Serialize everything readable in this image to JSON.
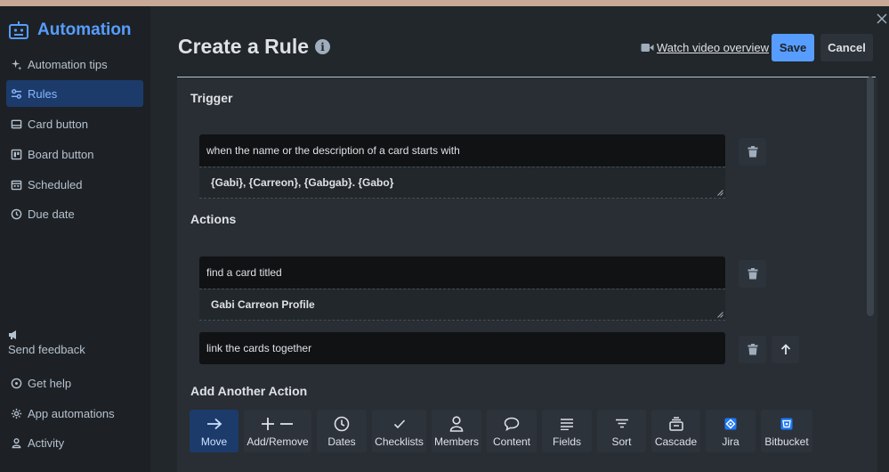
{
  "sidebar": {
    "title": "Automation",
    "items": [
      {
        "label": "Automation tips",
        "icon": "sparkle-icon"
      },
      {
        "label": "Rules",
        "icon": "sliders-icon",
        "active": true
      },
      {
        "label": "Card button",
        "icon": "card-icon"
      },
      {
        "label": "Board button",
        "icon": "board-icon"
      },
      {
        "label": "Scheduled",
        "icon": "calendar-icon"
      },
      {
        "label": "Due date",
        "icon": "clock-icon"
      }
    ],
    "feedback": "Send feedback",
    "bottom_items": [
      {
        "label": "Get help",
        "icon": "help-icon"
      },
      {
        "label": "App automations",
        "icon": "gear-icon"
      },
      {
        "label": "Activity",
        "icon": "person-icon"
      }
    ]
  },
  "header": {
    "title": "Create a Rule",
    "watch_label": "Watch video overview",
    "save_label": "Save",
    "cancel_label": "Cancel"
  },
  "trigger": {
    "heading": "Trigger",
    "text": "when the name or the description of a card starts with",
    "value": "{Gabi}, {Carreon}, {Gabgab}. {Gabo}"
  },
  "actions": {
    "heading": "Actions",
    "items": [
      {
        "text": "find a card titled",
        "value": "Gabi Carreon Profile"
      },
      {
        "text": "link the cards together"
      }
    ]
  },
  "add_action": {
    "heading": "Add Another Action",
    "tiles": [
      {
        "label": "Move",
        "icon": "arrow-right-icon",
        "active": true
      },
      {
        "label": "Add/Remove",
        "icon": "plus-minus-icon"
      },
      {
        "label": "Dates",
        "icon": "clock-icon"
      },
      {
        "label": "Checklists",
        "icon": "check-icon"
      },
      {
        "label": "Members",
        "icon": "person-icon"
      },
      {
        "label": "Content",
        "icon": "comment-icon"
      },
      {
        "label": "Fields",
        "icon": "lines-icon"
      },
      {
        "label": "Sort",
        "icon": "sort-icon"
      },
      {
        "label": "Cascade",
        "icon": "stack-icon"
      },
      {
        "label": "Jira",
        "icon": "jira-icon"
      },
      {
        "label": "Bitbucket",
        "icon": "bitbucket-icon"
      }
    ]
  },
  "colors": {
    "accent": "#579dff",
    "sidebar_bg": "#1d2125",
    "main_bg": "#22272b",
    "active_bg": "#1c3b6b"
  }
}
